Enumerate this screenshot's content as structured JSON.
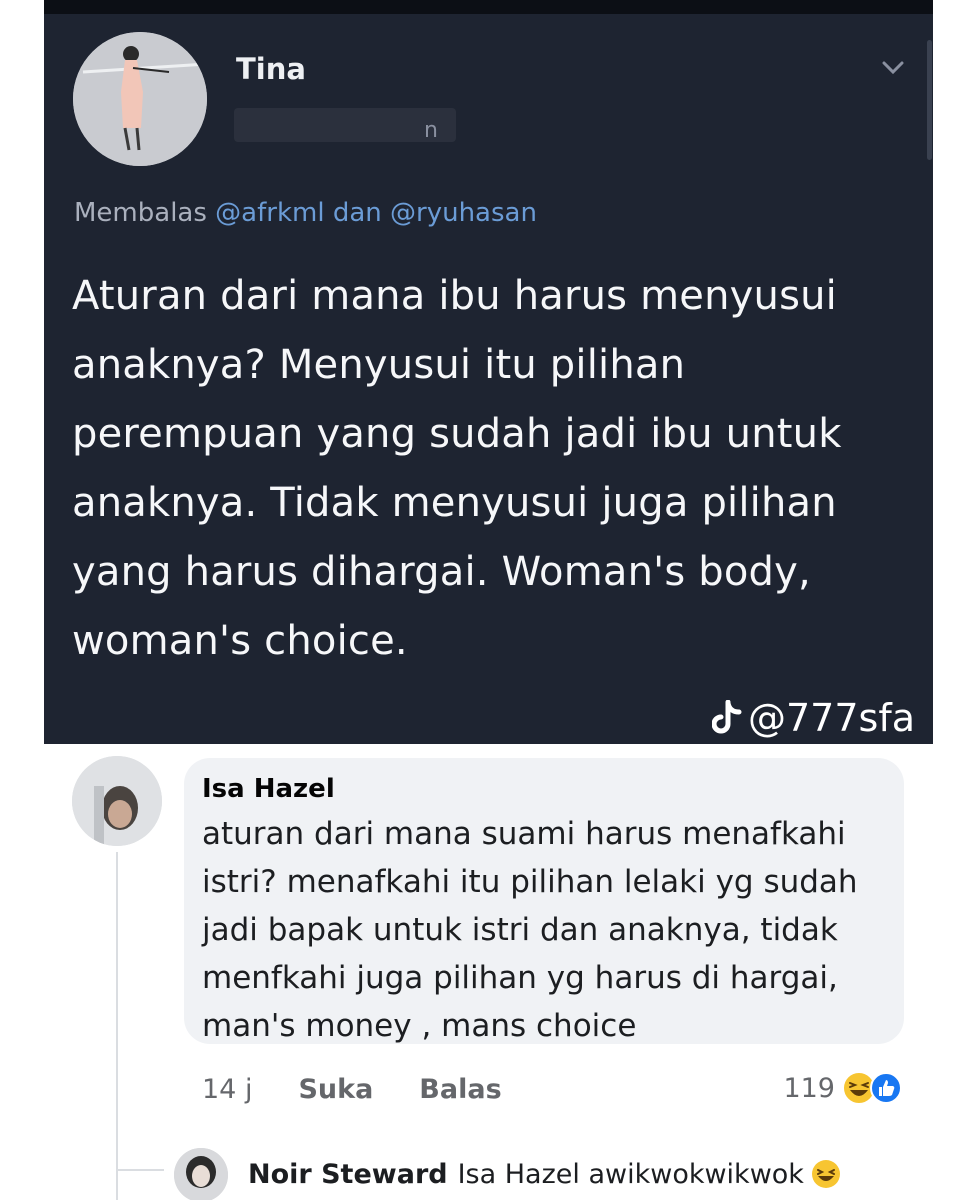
{
  "tweet": {
    "author": "Tina",
    "handle_tail": "n",
    "replying_prefix": "Membalas",
    "mention_1": "@afrkml",
    "replying_joiner": "dan",
    "mention_2": "@ryuhasan",
    "body": "Aturan dari mana ibu harus menyusui anaknya? Menyusui itu pilihan perempuan yang sudah jadi ibu untuk anaknya. Tidak menyusui juga pilihan yang harus dihargai. Woman's body, woman's choice.",
    "watermark": "@777sfa",
    "watermark_icon": "tiktok-icon"
  },
  "comment": {
    "author": "Isa Hazel",
    "text": "aturan dari mana suami harus menafkahi istri? menafkahi itu pilihan lelaki yg sudah jadi bapak untuk istri dan anaknya, tidak menfkahi juga pilihan yg harus di hargai, man's money , mans choice",
    "time": "14 j",
    "like_label": "Suka",
    "reply_label": "Balas",
    "reaction_count": "119",
    "reaction_icons": [
      "haha-emoji-icon",
      "like-reaction-icon"
    ]
  },
  "reply": {
    "author": "Noir Steward",
    "text": "Isa Hazel awikwokwikwok",
    "emoji_icon": "laughing-emoji-icon"
  },
  "colors": {
    "tweet_bg": "#1e2431",
    "mention": "#6b9cd6",
    "bubble_bg": "#f0f2f5",
    "meta_text": "#65676b",
    "like_blue": "#1877f2",
    "haha_yellow": "#f7c531"
  }
}
